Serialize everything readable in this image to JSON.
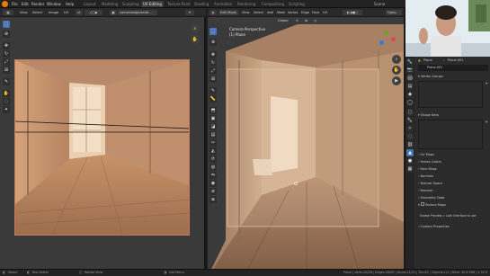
{
  "topbar": {
    "menus": [
      "File",
      "Edit",
      "Render",
      "Window",
      "Help"
    ],
    "workspaces": [
      "Layout",
      "Modeling",
      "Sculpting",
      "UV Editing",
      "Texture Paint",
      "Shading",
      "Animation",
      "Rendering",
      "Compositing",
      "Scripting"
    ],
    "active_workspace": "UV Editing",
    "scene": "Scene",
    "scene_box": "Scene"
  },
  "uv_editor": {
    "view": "View",
    "select": "Select",
    "image": "Image",
    "uv": "UV",
    "image_name": "cameraedge/eckb..."
  },
  "viewport": {
    "mode": "Edit Mode",
    "menus": [
      "View",
      "Select",
      "Add",
      "Mesh",
      "Vertex",
      "Edge",
      "Face",
      "UV"
    ],
    "transform": "Global",
    "overlay_title": "Camera Perspective",
    "overlay_subtitle": "(1) Plane",
    "options": "Optio"
  },
  "properties": {
    "object_name": "Plane",
    "data_name": "Plane.001",
    "mesh_name": "Plane.001",
    "sections": [
      "Vertex Groups",
      "Shape Keys",
      "UV Maps",
      "Vertex Colors",
      "Face Maps",
      "Normals",
      "Texture Space",
      "Remesh",
      "Geometry Data",
      "Texture Maps"
    ],
    "texture_maps_enable": "Enable Preview",
    "link_text": "Enable Preview > Lock Interface to use",
    "custom_properties": "Custom Properties"
  },
  "status": {
    "left": "Select",
    "left2": "Box Select",
    "mid": "Rotate View",
    "right_menu": "Call Menu",
    "stats": "Plane | Verts:28/28 | Edges:49/49 | Faces:21/21 | Tris:42 | Objects:1/2 | Mem: 40.6 MiB | 2.92.0"
  },
  "colors": {
    "accent": "#4772b3",
    "tint": "#d89868"
  }
}
